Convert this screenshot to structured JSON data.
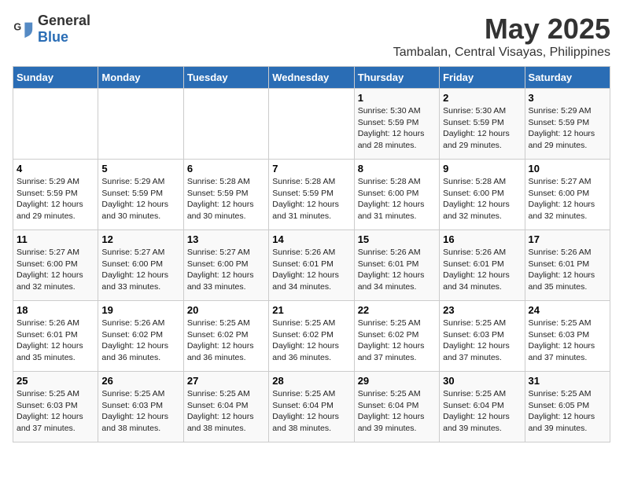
{
  "header": {
    "logo_general": "General",
    "logo_blue": "Blue",
    "title": "May 2025",
    "subtitle": "Tambalan, Central Visayas, Philippines"
  },
  "calendar": {
    "days_of_week": [
      "Sunday",
      "Monday",
      "Tuesday",
      "Wednesday",
      "Thursday",
      "Friday",
      "Saturday"
    ],
    "weeks": [
      [
        {
          "day": "",
          "info": ""
        },
        {
          "day": "",
          "info": ""
        },
        {
          "day": "",
          "info": ""
        },
        {
          "day": "",
          "info": ""
        },
        {
          "day": "1",
          "info": "Sunrise: 5:30 AM\nSunset: 5:59 PM\nDaylight: 12 hours\nand 28 minutes."
        },
        {
          "day": "2",
          "info": "Sunrise: 5:30 AM\nSunset: 5:59 PM\nDaylight: 12 hours\nand 29 minutes."
        },
        {
          "day": "3",
          "info": "Sunrise: 5:29 AM\nSunset: 5:59 PM\nDaylight: 12 hours\nand 29 minutes."
        }
      ],
      [
        {
          "day": "4",
          "info": "Sunrise: 5:29 AM\nSunset: 5:59 PM\nDaylight: 12 hours\nand 29 minutes."
        },
        {
          "day": "5",
          "info": "Sunrise: 5:29 AM\nSunset: 5:59 PM\nDaylight: 12 hours\nand 30 minutes."
        },
        {
          "day": "6",
          "info": "Sunrise: 5:28 AM\nSunset: 5:59 PM\nDaylight: 12 hours\nand 30 minutes."
        },
        {
          "day": "7",
          "info": "Sunrise: 5:28 AM\nSunset: 5:59 PM\nDaylight: 12 hours\nand 31 minutes."
        },
        {
          "day": "8",
          "info": "Sunrise: 5:28 AM\nSunset: 6:00 PM\nDaylight: 12 hours\nand 31 minutes."
        },
        {
          "day": "9",
          "info": "Sunrise: 5:28 AM\nSunset: 6:00 PM\nDaylight: 12 hours\nand 32 minutes."
        },
        {
          "day": "10",
          "info": "Sunrise: 5:27 AM\nSunset: 6:00 PM\nDaylight: 12 hours\nand 32 minutes."
        }
      ],
      [
        {
          "day": "11",
          "info": "Sunrise: 5:27 AM\nSunset: 6:00 PM\nDaylight: 12 hours\nand 32 minutes."
        },
        {
          "day": "12",
          "info": "Sunrise: 5:27 AM\nSunset: 6:00 PM\nDaylight: 12 hours\nand 33 minutes."
        },
        {
          "day": "13",
          "info": "Sunrise: 5:27 AM\nSunset: 6:00 PM\nDaylight: 12 hours\nand 33 minutes."
        },
        {
          "day": "14",
          "info": "Sunrise: 5:26 AM\nSunset: 6:01 PM\nDaylight: 12 hours\nand 34 minutes."
        },
        {
          "day": "15",
          "info": "Sunrise: 5:26 AM\nSunset: 6:01 PM\nDaylight: 12 hours\nand 34 minutes."
        },
        {
          "day": "16",
          "info": "Sunrise: 5:26 AM\nSunset: 6:01 PM\nDaylight: 12 hours\nand 34 minutes."
        },
        {
          "day": "17",
          "info": "Sunrise: 5:26 AM\nSunset: 6:01 PM\nDaylight: 12 hours\nand 35 minutes."
        }
      ],
      [
        {
          "day": "18",
          "info": "Sunrise: 5:26 AM\nSunset: 6:01 PM\nDaylight: 12 hours\nand 35 minutes."
        },
        {
          "day": "19",
          "info": "Sunrise: 5:26 AM\nSunset: 6:02 PM\nDaylight: 12 hours\nand 36 minutes."
        },
        {
          "day": "20",
          "info": "Sunrise: 5:25 AM\nSunset: 6:02 PM\nDaylight: 12 hours\nand 36 minutes."
        },
        {
          "day": "21",
          "info": "Sunrise: 5:25 AM\nSunset: 6:02 PM\nDaylight: 12 hours\nand 36 minutes."
        },
        {
          "day": "22",
          "info": "Sunrise: 5:25 AM\nSunset: 6:02 PM\nDaylight: 12 hours\nand 37 minutes."
        },
        {
          "day": "23",
          "info": "Sunrise: 5:25 AM\nSunset: 6:03 PM\nDaylight: 12 hours\nand 37 minutes."
        },
        {
          "day": "24",
          "info": "Sunrise: 5:25 AM\nSunset: 6:03 PM\nDaylight: 12 hours\nand 37 minutes."
        }
      ],
      [
        {
          "day": "25",
          "info": "Sunrise: 5:25 AM\nSunset: 6:03 PM\nDaylight: 12 hours\nand 37 minutes."
        },
        {
          "day": "26",
          "info": "Sunrise: 5:25 AM\nSunset: 6:03 PM\nDaylight: 12 hours\nand 38 minutes."
        },
        {
          "day": "27",
          "info": "Sunrise: 5:25 AM\nSunset: 6:04 PM\nDaylight: 12 hours\nand 38 minutes."
        },
        {
          "day": "28",
          "info": "Sunrise: 5:25 AM\nSunset: 6:04 PM\nDaylight: 12 hours\nand 38 minutes."
        },
        {
          "day": "29",
          "info": "Sunrise: 5:25 AM\nSunset: 6:04 PM\nDaylight: 12 hours\nand 39 minutes."
        },
        {
          "day": "30",
          "info": "Sunrise: 5:25 AM\nSunset: 6:04 PM\nDaylight: 12 hours\nand 39 minutes."
        },
        {
          "day": "31",
          "info": "Sunrise: 5:25 AM\nSunset: 6:05 PM\nDaylight: 12 hours\nand 39 minutes."
        }
      ]
    ]
  }
}
